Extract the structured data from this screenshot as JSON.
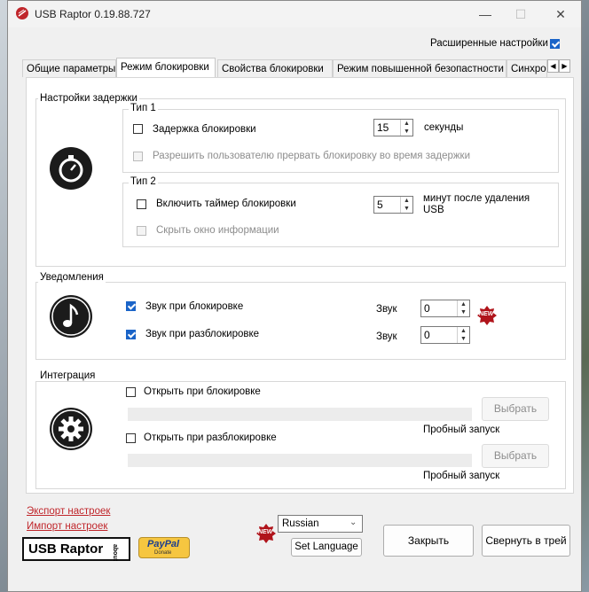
{
  "window": {
    "title": "USB Raptor 0.19.88.727"
  },
  "header": {
    "advanced_label": "Расширенные настройки",
    "advanced_checked": true
  },
  "tabs": [
    {
      "label": "Общие параметры"
    },
    {
      "label": "Режим блокировки"
    },
    {
      "label": "Свойства блокировки"
    },
    {
      "label": "Режим повышенной безопастности"
    },
    {
      "label": "Синхро"
    }
  ],
  "delay": {
    "title": "Настройки задержки",
    "type1": {
      "title": "Тип 1",
      "delay_label": "Задержка блокировки",
      "delay_value": "15",
      "delay_unit": "секунды",
      "allow_label": "Разрешить пользователю прервать блокировку во время задержки"
    },
    "type2": {
      "title": "Тип 2",
      "timer_label": "Включить таймер блокировки",
      "timer_value": "5",
      "timer_unit_1": "минут после удаления",
      "timer_unit_2": "USB",
      "hide_label": "Скрыть окно информации"
    }
  },
  "notifications": {
    "title": "Уведомления",
    "lock_sound_label": "Звук при блокировке",
    "unlock_sound_label": "Звук при разблокировке",
    "sound_label": "Звук",
    "lock_sound_value": "0",
    "unlock_sound_value": "0",
    "new_badge": "NEW"
  },
  "integration": {
    "title": "Интеграция",
    "open_on_lock_label": "Открыть при блокировке",
    "open_on_unlock_label": "Открыть при разблокировке",
    "choose_label": "Выбрать",
    "test_run_label": "Пробный запуск"
  },
  "footer": {
    "export_label": "Экспорт настроек",
    "import_label": "Импорт настроек",
    "logo_text": "USB Raptor",
    "about_text": "about",
    "paypal_text": "PayPal",
    "donate_text": "Donate",
    "new_badge": "NEW",
    "language_value": "Russian",
    "set_language_label": "Set Language",
    "close_label": "Закрыть",
    "minimize_label": "Свернуть в трей"
  }
}
